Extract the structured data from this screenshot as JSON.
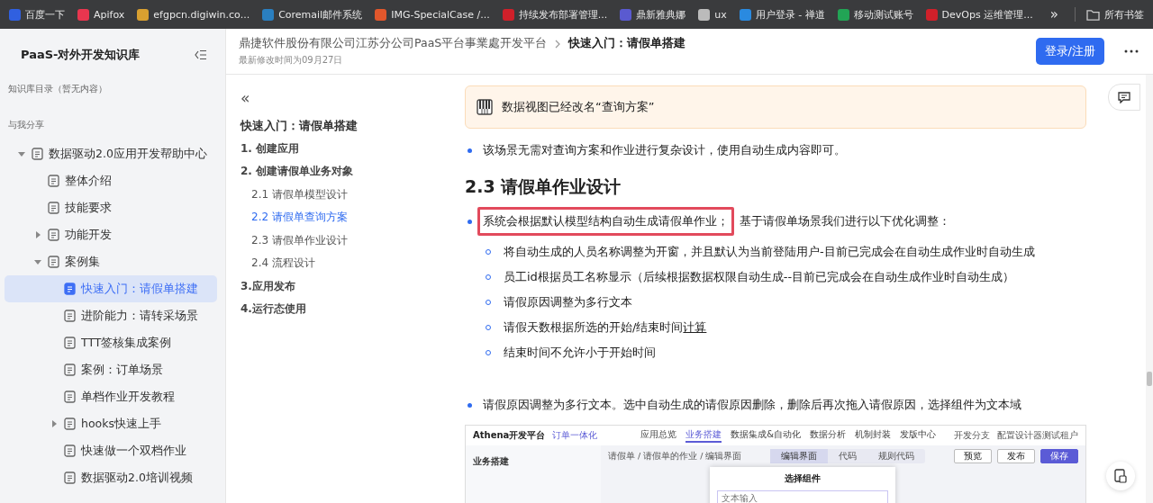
{
  "bookmarks": {
    "items": [
      {
        "label": "百度一下",
        "color": "#3060e0"
      },
      {
        "label": "Apifox",
        "color": "#e8364f"
      },
      {
        "label": "efgpcn.digiwin.co...",
        "color": "#d9a030"
      },
      {
        "label": "Coremail邮件系统",
        "color": "#2a7fc0"
      },
      {
        "label": "IMG-SpecialCase /...",
        "color": "#e2572c"
      },
      {
        "label": "持续发布部署管理...",
        "color": "#d0202a"
      },
      {
        "label": "鼎新雅典娜",
        "color": "#5a5ad0"
      },
      {
        "label": "ux",
        "color": "#bbbbbb"
      },
      {
        "label": "用户登录 - 禅道",
        "color": "#2a8ae0"
      },
      {
        "label": "移动测试账号",
        "color": "#22a455"
      },
      {
        "label": "DevOps 运维管理...",
        "color": "#d0202a"
      }
    ],
    "more": "»",
    "all": "所有书签"
  },
  "sidebar": {
    "title": "PaaS-对外开发知识库",
    "catalog": "知识库目录（暂无内容）",
    "shared": "与我分享",
    "tree": [
      {
        "label": "数据驱动2.0应用开发帮助中心",
        "expanded": true,
        "selected": false,
        "children": [
          {
            "label": "整体介绍",
            "selected": false
          },
          {
            "label": "技能要求",
            "selected": false
          },
          {
            "label": "功能开发",
            "expanded": false,
            "selected": false
          },
          {
            "label": "案例集",
            "expanded": true,
            "selected": false,
            "children": [
              {
                "label": "快速入门：请假单搭建",
                "selected": true
              },
              {
                "label": "进阶能力：请转采场景",
                "selected": false
              },
              {
                "label": "TTT签核集成案例",
                "selected": false
              },
              {
                "label": "案例：订单场景",
                "selected": false
              },
              {
                "label": "单档作业开发教程",
                "selected": false
              },
              {
                "label": "hooks快速上手",
                "expanded": false,
                "selected": false
              },
              {
                "label": "快速做一个双档作业",
                "selected": false
              },
              {
                "label": "数据驱动2.0培训视频",
                "selected": false
              }
            ]
          }
        ]
      }
    ]
  },
  "header": {
    "breadcrumb": [
      "鼎捷软件股份有限公司江苏分公司PaaS平台事業處开发平台",
      "快速入门：请假单搭建"
    ],
    "modified": "最新修改时间为09月27日",
    "login": "登录/注册"
  },
  "toc": {
    "collapse": "«",
    "items": [
      {
        "label": "快速入门：请假单搭建",
        "kind": "title",
        "selected": false
      },
      {
        "label": "1. 创建应用",
        "kind": "h1",
        "selected": false
      },
      {
        "label": "2. 创建请假单业务对象",
        "kind": "h1",
        "selected": false
      },
      {
        "label": "2.1 请假单模型设计",
        "kind": "h2",
        "selected": false
      },
      {
        "label": "2.2 请假单查询方案",
        "kind": "h2",
        "selected": true
      },
      {
        "label": "2.3 请假单作业设计",
        "kind": "h2",
        "selected": false
      },
      {
        "label": "2.4 流程设计",
        "kind": "h2",
        "selected": false
      },
      {
        "label": "3.应用发布",
        "kind": "h1",
        "selected": false
      },
      {
        "label": "4.运行态使用",
        "kind": "h1",
        "selected": false
      }
    ]
  },
  "article": {
    "callout": "数据视图已经改名“查询方案”",
    "bullet1": "该场景无需对查询方案和作业进行复杂设计，使用自动生成内容即可。",
    "heading": "2.3 请假单作业设计",
    "bullet2": {
      "highlighted": "系统会根据默认模型结构自动生成请假单作业；",
      "rest": "基于请假单场景我们进行以下优化调整：",
      "subitems": [
        {
          "text": "将自动生成的人员名称调整为开窗，并且默认为当前登陆用户-目前已完成会在自动生成作业时自动生成"
        },
        {
          "text": "员工id根据员工名称显示（后续根据数据权限自动生成--目前已完成会在自动生成作业时自动生成）"
        },
        {
          "text": "请假原因调整为多行文本"
        },
        {
          "text": "请假天数根据所选的开始/结束时间",
          "link": "计算"
        },
        {
          "text": "结束时间不允许小于开始时间"
        }
      ]
    },
    "bullet3": "请假原因调整为多行文本。选中自动生成的请假原因删除，删除后再次拖入请假原因，选择组件为文本域",
    "screenshot": {
      "brand": "Athena开发平台",
      "app": "订单一体化",
      "nav": [
        {
          "label": "应用总览",
          "selected": false
        },
        {
          "label": "业务搭建",
          "selected": true
        },
        {
          "label": "数据集成&自动化",
          "selected": false
        },
        {
          "label": "数据分析",
          "selected": false
        },
        {
          "label": "机制封装",
          "selected": false
        },
        {
          "label": "发版中心",
          "selected": false
        }
      ],
      "branch": "开发分支",
      "tenant": "配置设计器测试租户",
      "side_title": "业务搭建",
      "crumb": "请假单 / 请假单的作业 / 编辑界面",
      "tabs": [
        {
          "label": "编辑界面",
          "selected": true
        },
        {
          "label": "代码",
          "selected": false
        },
        {
          "label": "规则代码",
          "selected": false
        }
      ],
      "buttons": [
        "预览",
        "发布",
        "保存"
      ],
      "modal_title": "选择组件",
      "modal_placeholder": "文本输入"
    }
  }
}
